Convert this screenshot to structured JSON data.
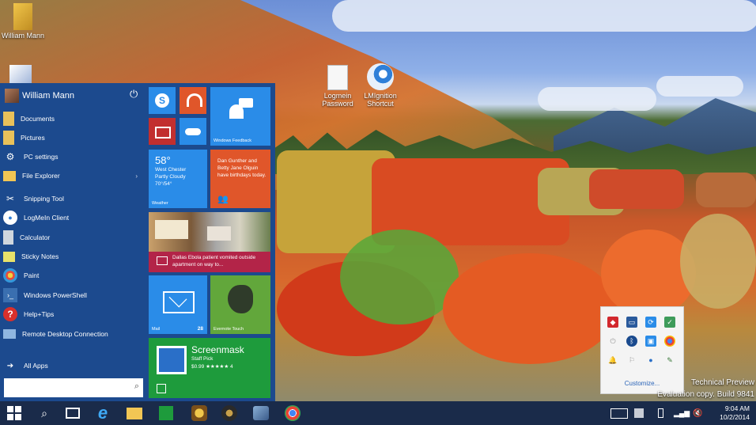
{
  "desktop_icons": [
    {
      "label": "William Mann"
    },
    {
      "label_line1": "Logmein",
      "label_line2": "Password"
    },
    {
      "label_line1": "LMIgnition",
      "label_line2": "Shortcut"
    }
  ],
  "start_menu": {
    "user_name": "William Mann",
    "power_glyph": "⏻",
    "items": [
      {
        "label": "Documents",
        "icon": "documents-folder-icon"
      },
      {
        "label": "Pictures",
        "icon": "pictures-folder-icon"
      },
      {
        "label": "PC settings",
        "icon": "gear-icon"
      },
      {
        "label": "File Explorer",
        "icon": "file-explorer-icon",
        "chevron": "›"
      },
      {
        "label": "Snipping Tool",
        "icon": "scissors-icon"
      },
      {
        "label": "LogMeIn Client",
        "icon": "logmein-icon"
      },
      {
        "label": "Calculator",
        "icon": "calculator-icon"
      },
      {
        "label": "Sticky Notes",
        "icon": "sticky-notes-icon"
      },
      {
        "label": "Paint",
        "icon": "paint-icon"
      },
      {
        "label": "Windows PowerShell",
        "icon": "powershell-icon"
      },
      {
        "label": "Help+Tips",
        "icon": "help-icon"
      },
      {
        "label": "Remote Desktop Connection",
        "icon": "remote-desktop-icon"
      }
    ],
    "all_apps": "All Apps",
    "all_apps_glyph": "➔",
    "search_glyph": "⌕"
  },
  "tiles": {
    "windows_feedback": "Windows Feedback",
    "weather": {
      "temp": "58°",
      "city": "West Chester",
      "cond": "Partly Cloudy",
      "range": "70°/54°",
      "label": "Weather"
    },
    "people": {
      "text": "Dan Gunther and Betty Jane Olguin have birthdays today."
    },
    "news": {
      "headline": "Dallas Ebola patient vomited outside apartment on way to..."
    },
    "mail": {
      "label": "Mail",
      "count": "28"
    },
    "evernote": {
      "label": "Evernote Touch"
    },
    "store": {
      "app": "Screenmask",
      "sub": "Staff Pick",
      "price": "$0.99 ★★★★★ 4"
    }
  },
  "tray_popup": {
    "customize": "Customize..."
  },
  "watermark": {
    "line1": "Technical Preview",
    "line2": "Evaluation copy. Build 9841"
  },
  "taskbar": {
    "time": "9:04 AM",
    "date": "10/2/2014"
  },
  "colors": {
    "start_bg": "#1c4a8e",
    "taskbar_bg": "#1a2b4a",
    "tile_blue": "#2a8ce8",
    "tile_orange": "#e0562a",
    "tile_red": "#c22f2f",
    "tile_green": "#1e9b3c",
    "tile_evernote": "#62a73b",
    "tile_crimson": "#b32448"
  }
}
